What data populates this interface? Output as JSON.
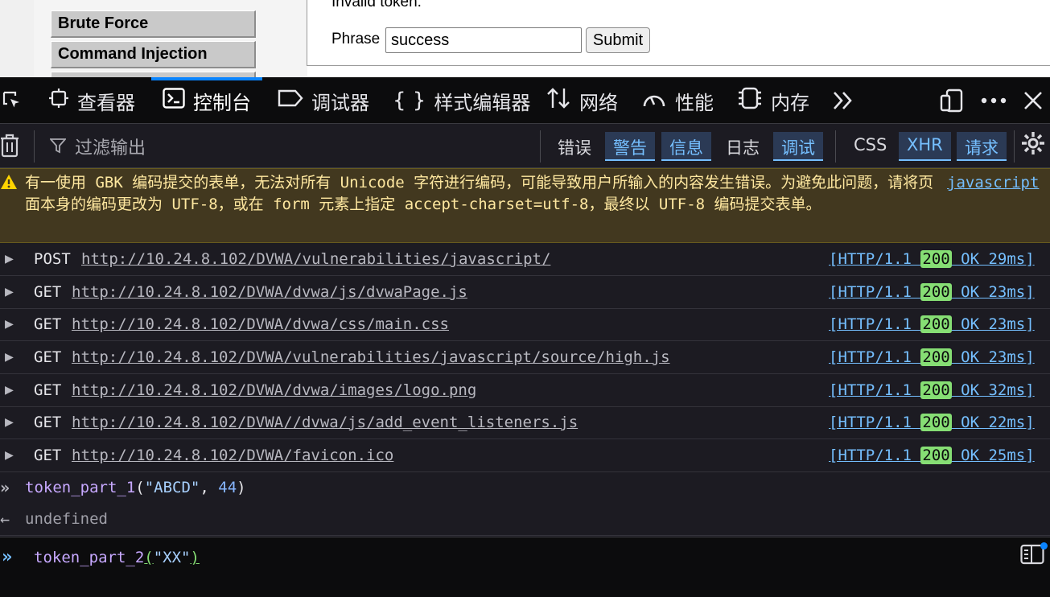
{
  "page": {
    "menu": [
      "Brute Force",
      "Command Injection",
      ""
    ],
    "message": "Invalid token.",
    "phrase_label": "Phrase",
    "phrase_value": "success",
    "submit_label": "Submit"
  },
  "devtools": {
    "tabs": [
      {
        "label": "查看器",
        "icon": "inspector-icon"
      },
      {
        "label": "控制台",
        "icon": "console-icon",
        "active": true
      },
      {
        "label": "调试器",
        "icon": "debugger-icon"
      },
      {
        "label": "样式编辑器",
        "icon": "style-editor-icon"
      },
      {
        "label": "网络",
        "icon": "network-icon"
      },
      {
        "label": "性能",
        "icon": "performance-icon"
      },
      {
        "label": "内存",
        "icon": "memory-icon"
      }
    ],
    "filter_placeholder": "过滤输出",
    "filters": [
      {
        "label": "错误",
        "on": false
      },
      {
        "label": "警告",
        "on": true
      },
      {
        "label": "信息",
        "on": true
      },
      {
        "label": "日志",
        "on": false
      },
      {
        "label": "调试",
        "on": true
      },
      {
        "label": "CSS",
        "on": false
      },
      {
        "label": "XHR",
        "on": true
      },
      {
        "label": "请求",
        "on": true
      }
    ]
  },
  "console": {
    "warning": {
      "text": "有一使用 GBK 编码提交的表单，无法对所有 Unicode 字符进行编码，可能导致用户所输入的内容发生错误。为避免此问题，请将页面本身的编码更改为 UTF-8，或在 form 元素上指定 accept-charset=utf-8，最终以 UTF-8 编码提交表单。",
      "source": "javascript"
    },
    "requests": [
      {
        "method": "POST",
        "url": "http://10.24.8.102/DVWA/vulnerabilities/javascript/",
        "proto": "[HTTP/1.1 ",
        "code": "200",
        "tail": " OK 29ms]"
      },
      {
        "method": "GET",
        "url": "http://10.24.8.102/DVWA/dvwa/js/dvwaPage.js",
        "proto": "[HTTP/1.1 ",
        "code": "200",
        "tail": " OK 23ms]"
      },
      {
        "method": "GET",
        "url": "http://10.24.8.102/DVWA/dvwa/css/main.css",
        "proto": "[HTTP/1.1 ",
        "code": "200",
        "tail": " OK 23ms]"
      },
      {
        "method": "GET",
        "url": "http://10.24.8.102/DVWA/vulnerabilities/javascript/source/high.js",
        "proto": "[HTTP/1.1 ",
        "code": "200",
        "tail": " OK 23ms]"
      },
      {
        "method": "GET",
        "url": "http://10.24.8.102/DVWA/dvwa/images/logo.png",
        "proto": "[HTTP/1.1 ",
        "code": "200",
        "tail": " OK 32ms]"
      },
      {
        "method": "GET",
        "url": "http://10.24.8.102/DVWA//dvwa/js/add_event_listeners.js",
        "proto": "[HTTP/1.1 ",
        "code": "200",
        "tail": " OK 22ms]"
      },
      {
        "method": "GET",
        "url": "http://10.24.8.102/DVWA/favicon.ico",
        "proto": "[HTTP/1.1 ",
        "code": "200",
        "tail": " OK 25ms]"
      }
    ],
    "command": {
      "fn": "token_part_1",
      "open": "(",
      "arg1": "\"ABCD\"",
      "comma": ", ",
      "arg2": "44",
      "close": ")"
    },
    "result": "undefined",
    "input": {
      "fn": "token_part_2",
      "open": "(",
      "arg": "\"XX\"",
      "close": ")"
    }
  }
}
